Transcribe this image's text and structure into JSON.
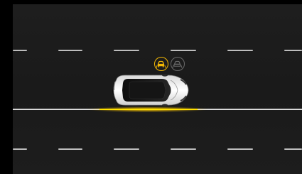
{
  "colors": {
    "road": "#1c1c1c",
    "lane_marking": "#d8d8d8",
    "warning": "#ffe100",
    "icon_active": "#f2b705",
    "icon_inactive": "#6a6a6a",
    "car_body": "#f2f2f2",
    "car_glass": "#111111"
  },
  "icons": {
    "active": {
      "name": "lane-keep-assist-icon",
      "state": "active"
    },
    "inactive": {
      "name": "lane-keep-assist-icon",
      "state": "inactive"
    }
  },
  "vehicle": {
    "name": "ego-car",
    "heading": "right"
  },
  "lane_warning": {
    "side": "right",
    "state": "active"
  }
}
